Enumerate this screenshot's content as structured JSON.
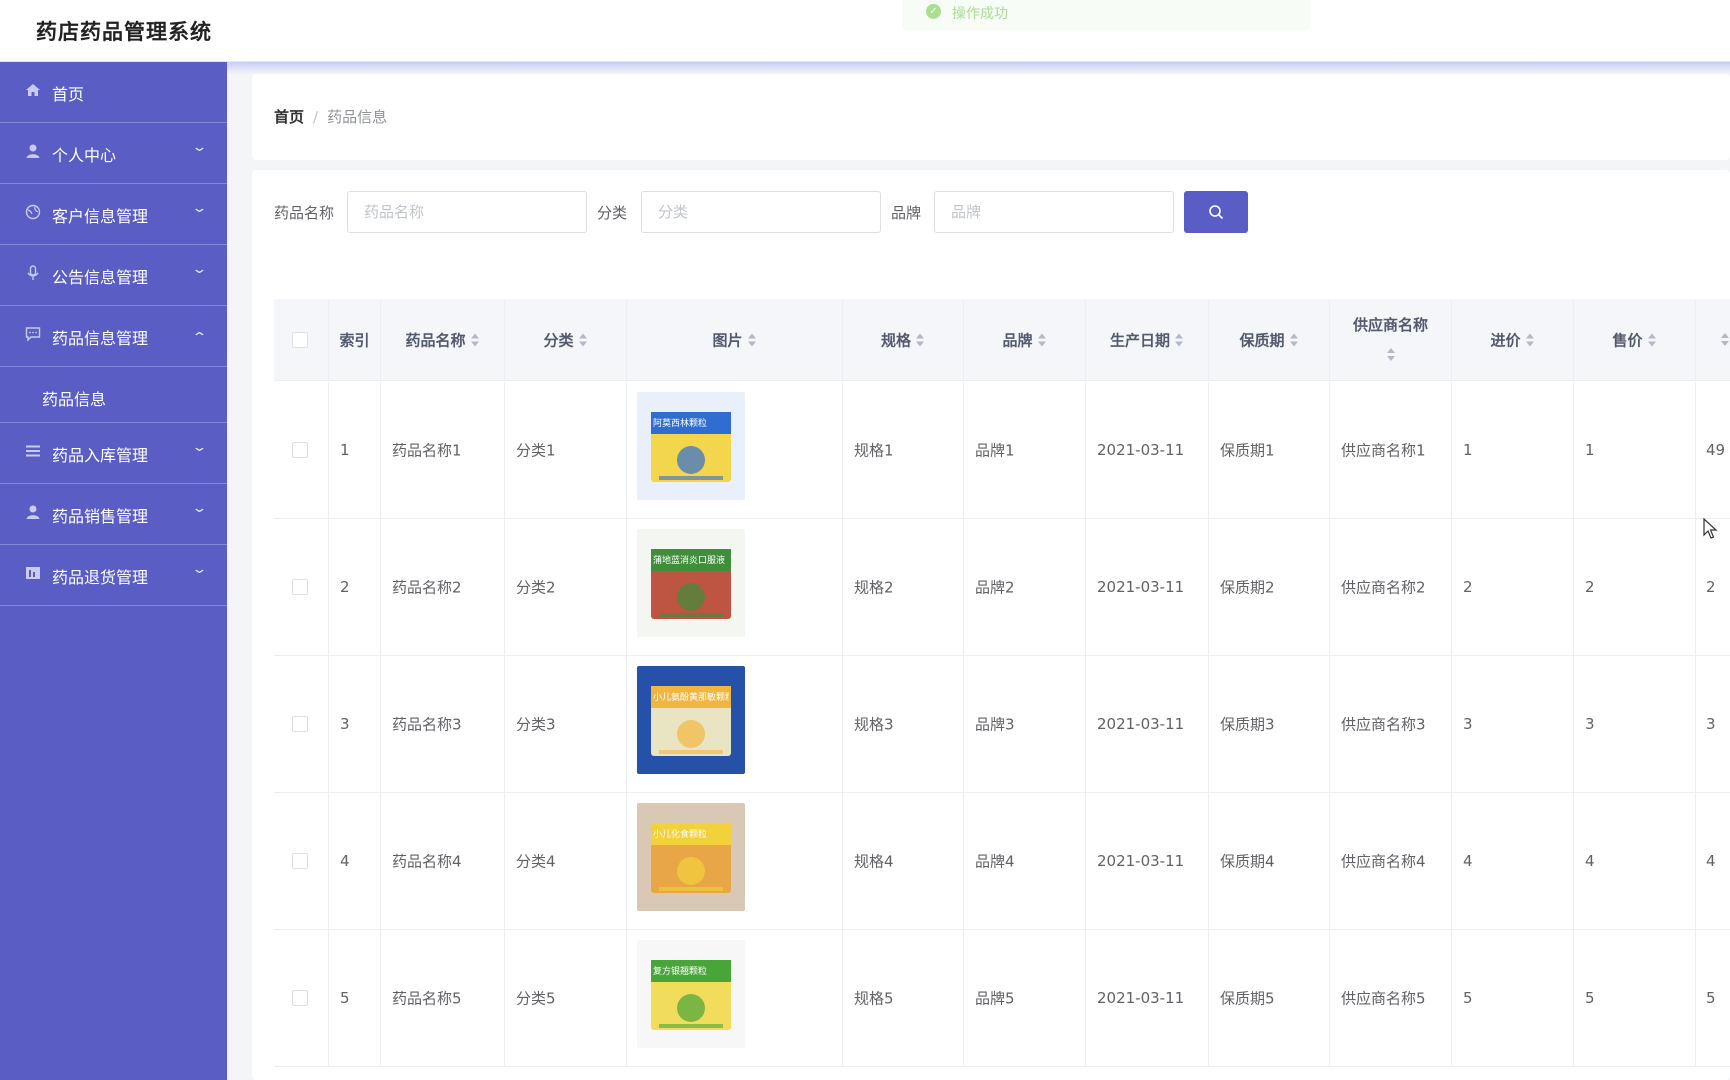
{
  "app": {
    "title": "药店药品管理系统"
  },
  "toast": {
    "text": "操作成功"
  },
  "sidebar": {
    "items": [
      {
        "label": "首页",
        "icon": "home-icon",
        "has_arrow": false
      },
      {
        "label": "个人中心",
        "icon": "user-icon",
        "has_arrow": true
      },
      {
        "label": "客户信息管理",
        "icon": "globe-icon",
        "has_arrow": true
      },
      {
        "label": "公告信息管理",
        "icon": "microphone-icon",
        "has_arrow": true
      },
      {
        "label": "药品信息管理",
        "icon": "chat-icon",
        "has_arrow": true,
        "expanded": true
      },
      {
        "label": "药品信息",
        "submenu": true
      },
      {
        "label": "药品入库管理",
        "icon": "list-icon",
        "has_arrow": true
      },
      {
        "label": "药品销售管理",
        "icon": "user-icon",
        "has_arrow": true
      },
      {
        "label": "药品退货管理",
        "icon": "chart-icon",
        "has_arrow": true
      }
    ]
  },
  "breadcrumb": {
    "home": "首页",
    "separator": "/",
    "current": "药品信息"
  },
  "search": {
    "name_label": "药品名称",
    "name_placeholder": "药品名称",
    "category_label": "分类",
    "category_placeholder": "分类",
    "brand_label": "品牌",
    "brand_placeholder": "品牌",
    "button_icon": "search-icon"
  },
  "table": {
    "headers": [
      "索引",
      "药品名称",
      "分类",
      "图片",
      "规格",
      "品牌",
      "生产日期",
      "保质期",
      "供应商名称",
      "进价",
      "售价"
    ],
    "rows": [
      {
        "index": "1",
        "name": "药品名称1",
        "category": "分类1",
        "spec": "规格1",
        "brand": "品牌1",
        "date": "2021-03-11",
        "shelf": "保质期1",
        "supplier": "供应商名称1",
        "cost": "1",
        "price": "1",
        "extra": "49"
      },
      {
        "index": "2",
        "name": "药品名称2",
        "category": "分类2",
        "spec": "规格2",
        "brand": "品牌2",
        "date": "2021-03-11",
        "shelf": "保质期2",
        "supplier": "供应商名称2",
        "cost": "2",
        "price": "2",
        "extra": "2"
      },
      {
        "index": "3",
        "name": "药品名称3",
        "category": "分类3",
        "spec": "规格3",
        "brand": "品牌3",
        "date": "2021-03-11",
        "shelf": "保质期3",
        "supplier": "供应商名称3",
        "cost": "3",
        "price": "3",
        "extra": "3"
      },
      {
        "index": "4",
        "name": "药品名称4",
        "category": "分类4",
        "spec": "规格4",
        "brand": "品牌4",
        "date": "2021-03-11",
        "shelf": "保质期4",
        "supplier": "供应商名称4",
        "cost": "4",
        "price": "4",
        "extra": "4"
      },
      {
        "index": "5",
        "name": "药品名称5",
        "category": "分类5",
        "spec": "规格5",
        "brand": "品牌5",
        "date": "2021-03-11",
        "shelf": "保质期5",
        "supplier": "供应商名称5",
        "cost": "5",
        "price": "5",
        "extra": "5"
      }
    ],
    "thumb_labels": [
      "阿莫西林颗粒",
      "蒲地蓝消炎口服液",
      "小儿氨酚黄那敏颗粒",
      "小儿化食颗粒",
      "复方银翘颗粒"
    ]
  },
  "colors": {
    "primary": "#5a5ec4",
    "success": "#67c23a"
  }
}
